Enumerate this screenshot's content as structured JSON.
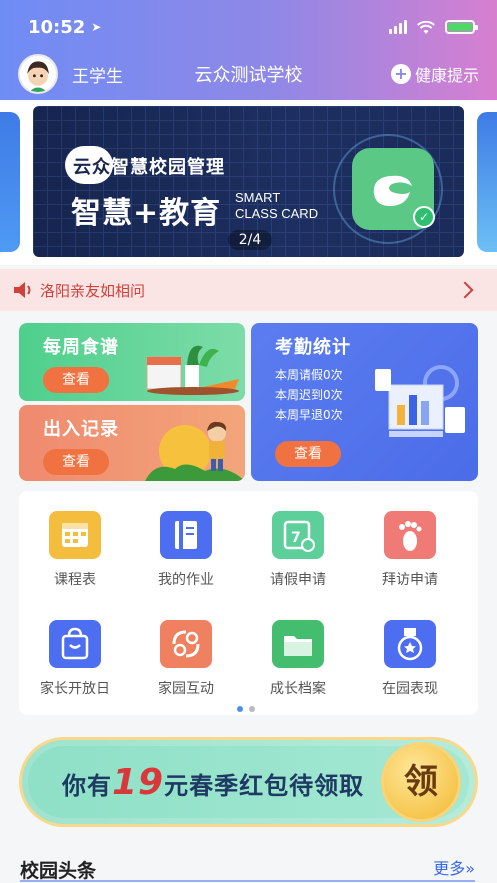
{
  "status_bar": {
    "time": "10:52"
  },
  "header": {
    "username": "王学生",
    "school_name": "云众测试学校",
    "health_label": "健康提示"
  },
  "banner": {
    "brand_prefix": "云众",
    "brand_suffix": "智慧校园管理",
    "headline": "智慧+教育",
    "sub_line1": "SMART",
    "sub_line2": "CLASS CARD",
    "page_indicator": "2/4"
  },
  "notice": {
    "text": "洛阳亲友如相问"
  },
  "cards": {
    "food": {
      "title": "每周食谱",
      "button": "查看"
    },
    "gate": {
      "title": "出入记录",
      "button": "查看"
    },
    "attendance": {
      "title": "考勤统计",
      "stats": [
        "本周请假0次",
        "本周迟到0次",
        "本周早退0次"
      ],
      "button": "查看"
    }
  },
  "grid": {
    "items": [
      {
        "label": "课程表"
      },
      {
        "label": "我的作业"
      },
      {
        "label": "请假申请"
      },
      {
        "label": "拜访申请"
      },
      {
        "label": "家长开放日"
      },
      {
        "label": "家园互动"
      },
      {
        "label": "成长档案"
      },
      {
        "label": "在园表现"
      }
    ],
    "page_dots": 2,
    "active_dot": 1
  },
  "promo": {
    "prefix": "你有",
    "amount": "19",
    "suffix": "元春季红包待领取",
    "coin_label": "领"
  },
  "news": {
    "title": "校园头条",
    "more_label": "更多"
  },
  "colors": {
    "header_start": "#6f8cf5",
    "header_end": "#d77fd0",
    "notice_bg": "#fbe5e4",
    "notice_text": "#d1403a",
    "accent": "#3a67e8"
  }
}
